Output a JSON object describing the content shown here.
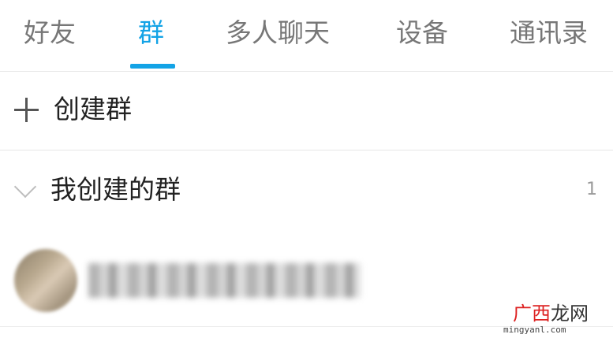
{
  "tabs": [
    {
      "label": "好友",
      "active": false
    },
    {
      "label": "群",
      "active": true
    },
    {
      "label": "多人聊天",
      "active": false
    },
    {
      "label": "设备",
      "active": false
    },
    {
      "label": "通讯录",
      "active": false
    }
  ],
  "accent_color": "#13a3e6",
  "create_group": {
    "label": "创建群",
    "icon": "plus-icon"
  },
  "my_groups": {
    "label": "我创建的群",
    "count": "1",
    "icon": "chevron-down-icon"
  },
  "group_item": {
    "name": "",
    "avatar": "blurred"
  },
  "watermark": {
    "logo_red": "广西",
    "logo_black": "龙网",
    "url": "mingyanl.com"
  }
}
